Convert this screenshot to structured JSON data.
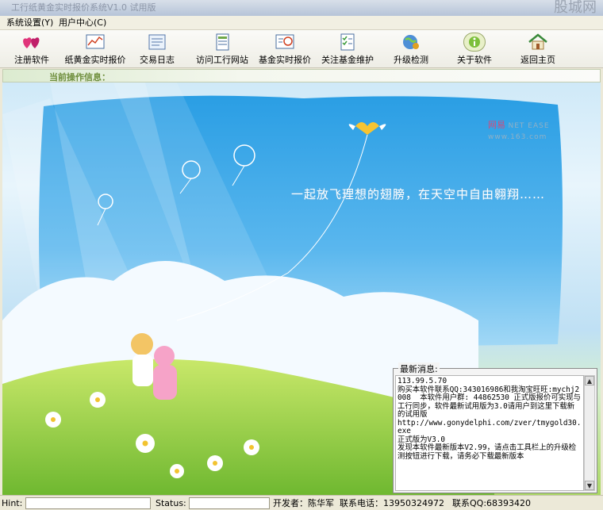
{
  "window": {
    "title": "工行纸黄金实时报价系统V1.0 试用版",
    "watermark": "股城网"
  },
  "menu": [
    {
      "label": "系统设置(Y)"
    },
    {
      "label": "用户中心(C)"
    }
  ],
  "toolbar": [
    {
      "label": "注册软件",
      "icon": "hearts-icon"
    },
    {
      "label": "纸黄金实时报价",
      "icon": "chart-icon"
    },
    {
      "label": "交易日志",
      "icon": "log-icon"
    },
    {
      "label": "访问工行网站",
      "icon": "document-icon"
    },
    {
      "label": "基金实时报价",
      "icon": "fund-chart-icon"
    },
    {
      "label": "关注基金维护",
      "icon": "checklist-icon"
    },
    {
      "label": "升级检测",
      "icon": "globe-icon"
    },
    {
      "label": "关于软件",
      "icon": "about-icon"
    },
    {
      "label": "返回主页",
      "icon": "home-icon"
    }
  ],
  "info_label": "当前操作信息：",
  "banner": {
    "slogan": "一起放飞理想的翅膀，在天空中自由翱翔……",
    "brand_cn": "网易",
    "brand_en": "NET EASE",
    "brand_url": "www.163.com"
  },
  "news": {
    "title": "最新消息:",
    "text": "113.99.5.70\n购买本软件联系QQ:343016986和我淘宝旺旺:mychj2008  本软件用户群: 44862530 正式版报价可实现与工行同步，软件最新试用版为3.0请用户到这里下载新的试用版\nhttp://www.gonydelphi.com/zver/tmygold30.exe\n正式版为V3.0\n发现本软件最新版本V2.99，请点击工具栏上的升级检测按钮进行下载，请务必下载最新版本"
  },
  "status": {
    "hint_label": "Hint:",
    "status_label": "Status:",
    "developer": "开发者：陈华军",
    "phone": "联系电话：13950324972",
    "qq": "联系QQ:68393420"
  }
}
